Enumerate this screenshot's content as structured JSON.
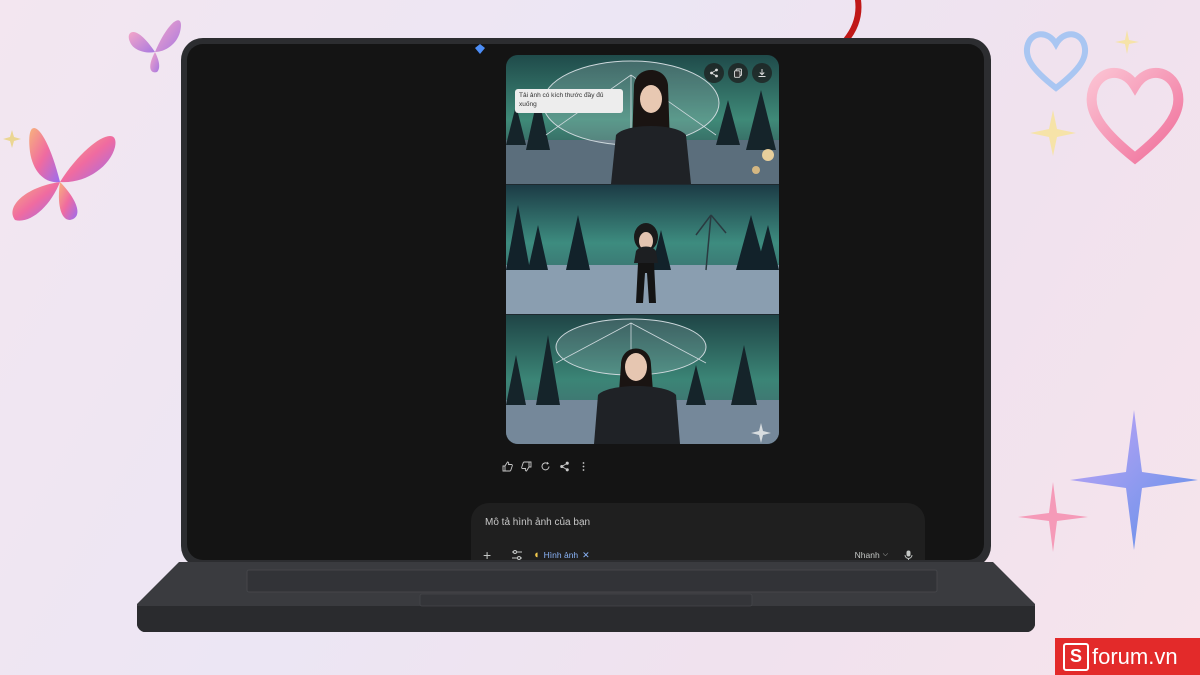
{
  "tooltip": {
    "text": "Tải ảnh có kích thước đầy đủ xuống"
  },
  "composer": {
    "placeholder": "Mô tả hình ảnh của bạn",
    "chip_label": "Hình ảnh",
    "mode_label": "Nhanh"
  },
  "image_actions": [
    "share-icon",
    "copy-icon",
    "download-icon"
  ],
  "feedback_icons": [
    "thumbs-up-icon",
    "thumbs-down-icon",
    "regenerate-icon",
    "share-icon",
    "more-vert-icon"
  ],
  "brand": {
    "name": "forum.vn",
    "mark": "S"
  },
  "colors": {
    "accent_blue": "#8ab4f8",
    "arrow_red": "#c01818",
    "brand_red": "#e32a2a",
    "screen_bg": "#141414"
  }
}
